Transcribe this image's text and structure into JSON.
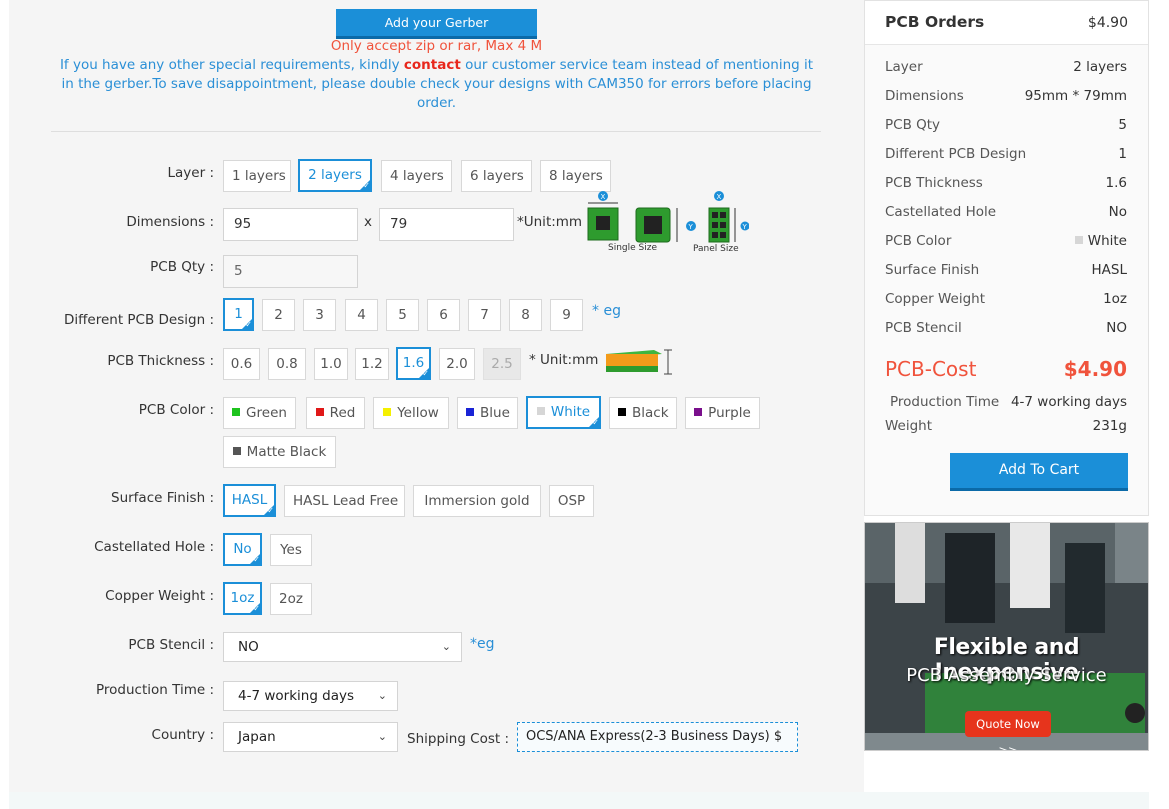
{
  "upload": {
    "button": "Add your Gerber",
    "note_red": "Only accept zip or rar, Max 4 M",
    "note_blue_1": "If you have any other special requirements, kindly ",
    "note_blue_link": "contact",
    "note_blue_2": " our customer service team instead of mentioning it in the gerber.To save disappointment, please double check your designs with CAM350 for errors before placing order."
  },
  "form": {
    "layer": {
      "label": "Layer :",
      "options": [
        "1 layers",
        "2 layers",
        "4 layers",
        "6 layers",
        "8 layers"
      ],
      "selected": "2 layers"
    },
    "dimensions": {
      "label": "Dimensions :",
      "width": "95",
      "height": "79",
      "x": "x",
      "unit": "*Unit:mm",
      "single_caption": "Single Size",
      "panel_caption": "Panel Size"
    },
    "qty": {
      "label": "PCB Qty :",
      "value": "5"
    },
    "design": {
      "label": "Different PCB Design :",
      "options": [
        "1",
        "2",
        "3",
        "4",
        "5",
        "6",
        "7",
        "8",
        "9"
      ],
      "selected": "1",
      "eg": "* eg"
    },
    "thickness": {
      "label": "PCB Thickness :",
      "options": [
        "0.6",
        "0.8",
        "1.0",
        "1.2",
        "1.6",
        "2.0",
        "2.5"
      ],
      "selected": "1.6",
      "disabled": "2.5",
      "unit": "* Unit:mm"
    },
    "color": {
      "label": "PCB Color :",
      "options": [
        {
          "name": "Green",
          "swatch": "#1ec31e"
        },
        {
          "name": "Red",
          "swatch": "#e01818"
        },
        {
          "name": "Yellow",
          "swatch": "#f5f000"
        },
        {
          "name": "Blue",
          "swatch": "#1a23d6"
        },
        {
          "name": "White",
          "swatch": "#d6d6d6"
        },
        {
          "name": "Black",
          "swatch": "#000000"
        },
        {
          "name": "Purple",
          "swatch": "#7a0f8c"
        },
        {
          "name": "Matte Black",
          "swatch": "#555555"
        }
      ],
      "selected": "White"
    },
    "finish": {
      "label": "Surface Finish :",
      "options": [
        "HASL",
        "HASL Lead Free",
        "Immersion gold",
        "OSP"
      ],
      "selected": "HASL"
    },
    "castellated": {
      "label": "Castellated Hole :",
      "options": [
        "No",
        "Yes"
      ],
      "selected": "No"
    },
    "copper": {
      "label": "Copper Weight :",
      "options": [
        "1oz",
        "2oz"
      ],
      "selected": "1oz"
    },
    "stencil": {
      "label": "PCB Stencil :",
      "value": "NO",
      "eg": "*eg"
    },
    "production": {
      "label": "Production Time :",
      "value": "4-7 working days"
    },
    "country": {
      "label": "Country :",
      "value": "Japan"
    },
    "shipping": {
      "label": "Shipping Cost :",
      "value": "OCS/ANA Express(2-3 Business Days) $"
    }
  },
  "summary": {
    "title": "PCB Orders",
    "total": "$4.90",
    "rows": [
      {
        "k": "Layer",
        "v": "2 layers"
      },
      {
        "k": "Dimensions",
        "v": "95mm * 79mm"
      },
      {
        "k": "PCB Qty",
        "v": "5"
      },
      {
        "k": "Different PCB Design",
        "v": "1"
      },
      {
        "k": "PCB Thickness",
        "v": "1.6"
      },
      {
        "k": "Castellated Hole",
        "v": "No"
      },
      {
        "k": "PCB Color",
        "v": "White",
        "swatch": "#d6d6d6"
      },
      {
        "k": "Surface Finish",
        "v": "HASL"
      },
      {
        "k": "Copper Weight",
        "v": "1oz"
      },
      {
        "k": "PCB Stencil",
        "v": "NO"
      }
    ],
    "cost_label": "PCB-Cost",
    "cost_value": "$4.90",
    "production_label": "Production Time",
    "production_value": "4-7 working days",
    "weight_label": "Weight",
    "weight_value": "231g",
    "cart_button": "Add To Cart"
  },
  "ad": {
    "line1": "Flexible and Inexpensive",
    "line2": "PCB Assembly Service",
    "button": "Quote Now >>"
  },
  "colors": {
    "accent": "#1b8fd8",
    "alert": "#f0533c",
    "link": "#2a8fd6"
  }
}
